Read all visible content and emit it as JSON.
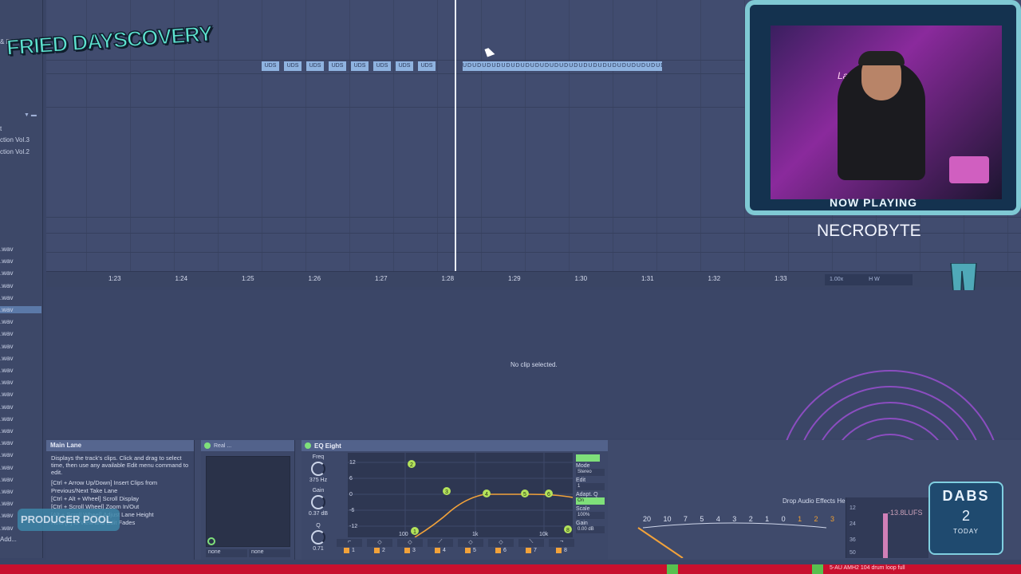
{
  "browser": {
    "fx_label": "& FX",
    "items": [
      "t",
      "ction Vol.3",
      "ction Vol.2"
    ],
    "wav_label": ".wav",
    "add_label": "Add..."
  },
  "logo": {
    "text": "FRIED DAYSCOVERY"
  },
  "arrangement": {
    "clip_label": "UDS",
    "dense_clip_text": "UDUDUDUDUDUDUDUDUDUDUDUDUDUDUDUDUDUDUDUDUDUDUDUDUDUDUDUD",
    "ruler_ticks": [
      "1:23",
      "1:24",
      "1:25",
      "1:26",
      "1:27",
      "1:28",
      "1:29",
      "1:30",
      "1:31",
      "1:32",
      "1:33"
    ],
    "zoom_value": "1.00x",
    "hw_labels": "H  W"
  },
  "webcam": {
    "neon_sign": "LaVedk",
    "now_playing": "NOW PLAYING",
    "artist": "NECROBYTE"
  },
  "clip_view": {
    "empty_message": "No clip selected."
  },
  "info_panel": {
    "title": "Main Lane",
    "description": "Displays the track's clips. Click and drag to select time, then use any available Edit menu command to edit.",
    "shortcuts": [
      "[Ctrl + Arrow Up/Down] Insert Clips from",
      "Previous/Next Take Lane",
      "[Ctrl + Alt + Wheel] Scroll Display",
      "[Ctrl + Scroll Wheel] Zoom In/Out",
      "[Alt + Scroll Wheel] Adjust Lane Height",
      "Hold [F] to View and Edit Fades"
    ],
    "badge": "PRODUCER POOL"
  },
  "real_device": {
    "title": "Real ...",
    "dropdown_left": "none",
    "dropdown_right": "none"
  },
  "eq": {
    "title": "EQ Eight",
    "freq_label": "Freq",
    "freq_value": "375 Hz",
    "gain_label": "Gain",
    "gain_value": "0.37 dB",
    "q_label": "Q",
    "q_value": "0.71",
    "db_ticks": [
      "12",
      "6",
      "0",
      "-6",
      "-12"
    ],
    "freq_ticks": [
      "100",
      "1k",
      "10k"
    ],
    "mode_label": "Mode",
    "mode_value": "Stereo",
    "edit_label": "Edit",
    "edit_value": "1",
    "adapt_label": "Adapt. Q",
    "adapt_value": "On",
    "scale_label": "Scale",
    "scale_value": "100%",
    "gain_out_label": "Gain",
    "gain_out_value": "0.00 dB",
    "bands": [
      "1",
      "2",
      "3",
      "4",
      "5",
      "6",
      "7",
      "8"
    ]
  },
  "meters": {
    "drop_text": "Drop Audio Effects Here",
    "vu_labels": [
      "20",
      "10",
      "7",
      "5",
      "4",
      "3",
      "2",
      "1",
      "0",
      "1",
      "2",
      "3"
    ],
    "lufs_value": "-13.8LUFS",
    "lufs_scale": [
      "12",
      "24",
      "36",
      "50"
    ]
  },
  "dabs": {
    "title": "DABS",
    "count": "2",
    "label": "TODAY"
  },
  "status": {
    "text": "5-AU AMH2 104 drum loop full"
  },
  "colors": {
    "accent_green": "#7fe07a",
    "eq_curve": "#f2a23a",
    "status_red": "#c8102e",
    "clip_blue": "#8fb3e0"
  }
}
